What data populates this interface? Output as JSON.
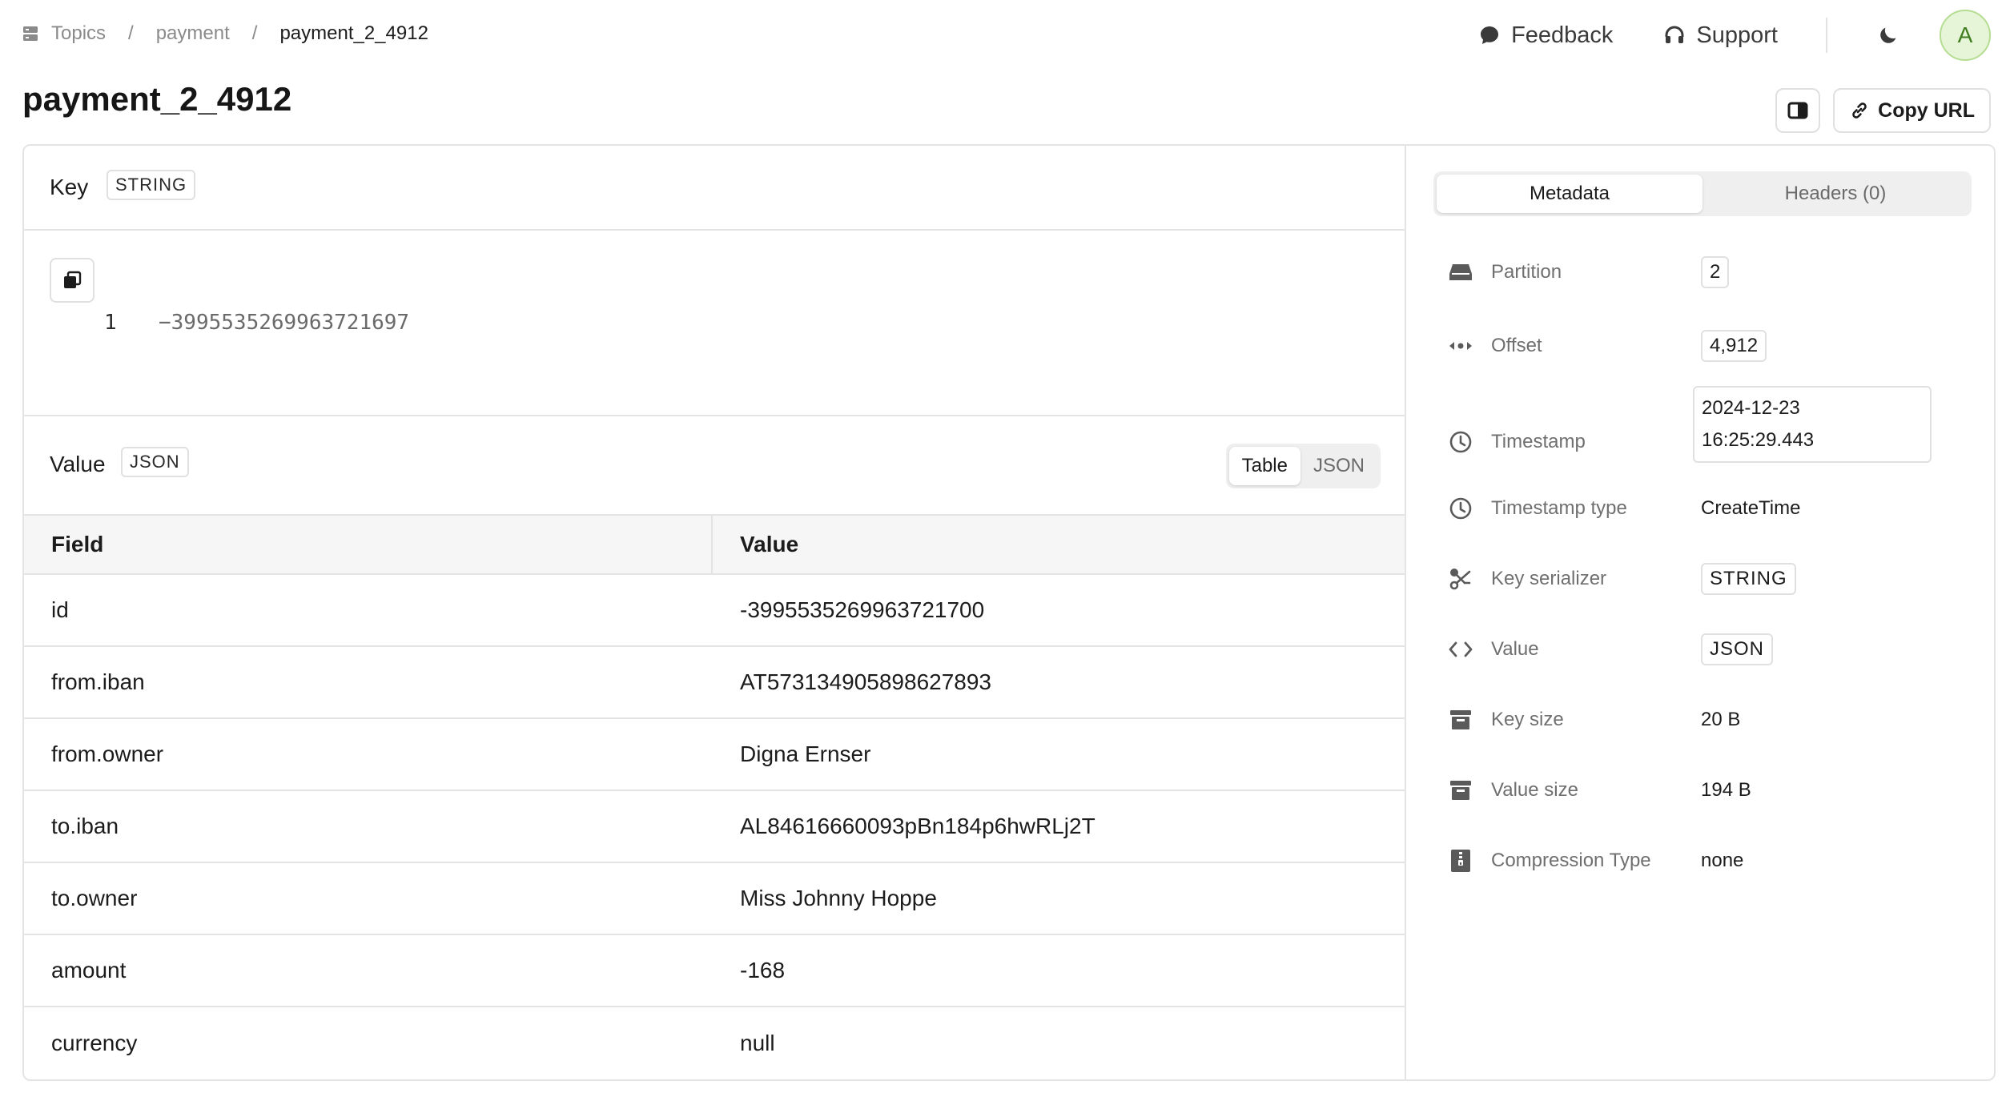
{
  "breadcrumb": {
    "root": "Topics",
    "parent": "payment",
    "current": "payment_2_4912"
  },
  "topnav": {
    "feedback": "Feedback",
    "support": "Support",
    "avatar_initial": "A"
  },
  "page_title": "payment_2_4912",
  "actions": {
    "copy_url": "Copy URL"
  },
  "key": {
    "label": "Key",
    "type_badge": "STRING",
    "line_number": "1",
    "content": "−3995535269963721697"
  },
  "value": {
    "label": "Value",
    "type_badge": "JSON",
    "view_options": [
      "Table",
      "JSON"
    ],
    "selected_view": "Table",
    "table": {
      "columns": [
        "Field",
        "Value"
      ],
      "rows": [
        [
          "id",
          "-3995535269963721700"
        ],
        [
          "from.iban",
          "AT573134905898627893"
        ],
        [
          "from.owner",
          "Digna Ernser"
        ],
        [
          "to.iban",
          "AL84616660093pBn184p6hwRLj2T"
        ],
        [
          "to.owner",
          "Miss Johnny Hoppe"
        ],
        [
          "amount",
          "-168"
        ],
        [
          "currency",
          "null"
        ]
      ]
    }
  },
  "side_tabs": {
    "metadata": "Metadata",
    "headers": "Headers (0)",
    "active": "Metadata"
  },
  "metadata": {
    "partition": {
      "label": "Partition",
      "value": "2"
    },
    "offset": {
      "label": "Offset",
      "value": "4,912"
    },
    "timestamp": {
      "label": "Timestamp",
      "date": "2024-12-23",
      "time": "16:25:29.443"
    },
    "timestamp_type": {
      "label": "Timestamp type",
      "value": "CreateTime"
    },
    "key_serializer": {
      "label": "Key serializer",
      "value": "STRING"
    },
    "value_serializer": {
      "label": "Value",
      "value": "JSON"
    },
    "key_size": {
      "label": "Key size",
      "value": "20 B"
    },
    "value_size": {
      "label": "Value size",
      "value": "194 B"
    },
    "compression": {
      "label": "Compression Type",
      "value": "none"
    }
  }
}
